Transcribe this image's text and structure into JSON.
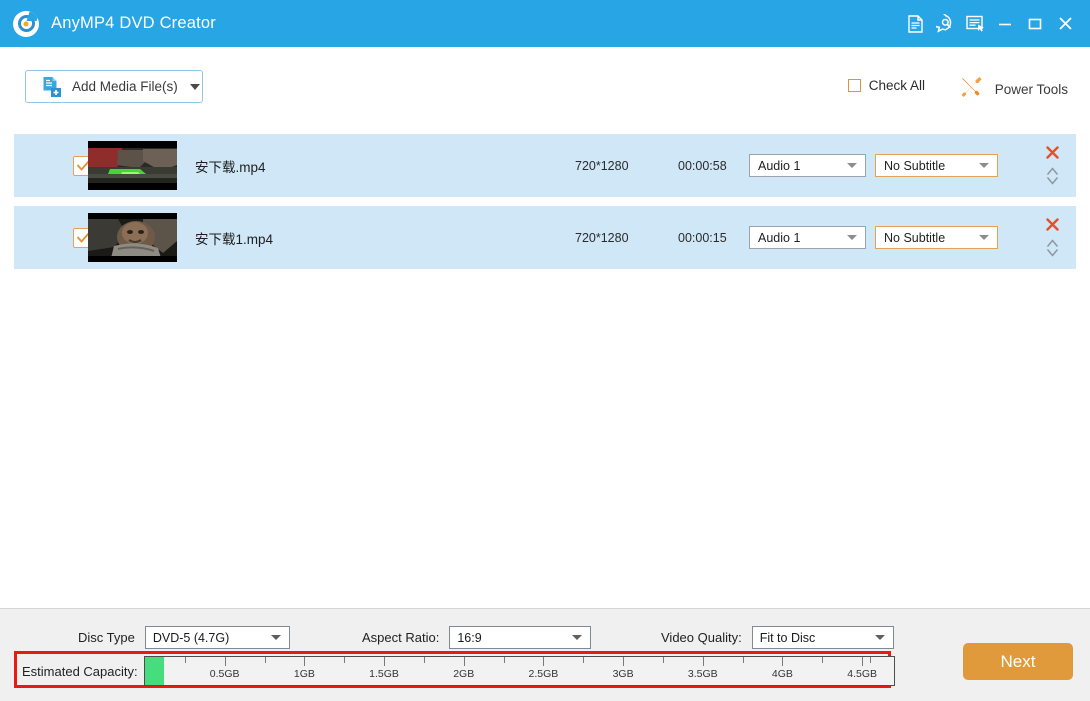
{
  "window": {
    "title": "AnyMP4 DVD Creator",
    "logo_icon": "anymp4-logo-icon",
    "titlebar_color": "#27a5e5",
    "buttons": [
      {
        "name": "register-icon",
        "glyph": "document"
      },
      {
        "name": "help-icon",
        "glyph": "speech-question"
      },
      {
        "name": "feedback-icon",
        "glyph": "form-cursor"
      },
      {
        "name": "minimize-icon",
        "glyph": "minimize"
      },
      {
        "name": "maximize-icon",
        "glyph": "maximize"
      },
      {
        "name": "close-icon",
        "glyph": "close"
      }
    ]
  },
  "toolbar": {
    "add_media_label": "Add Media File(s)",
    "add_media_icon": "add-file-icon",
    "check_all_label": "Check All",
    "check_all_checked": false,
    "power_tools_label": "Power Tools",
    "power_tools_icon": "tools-icon",
    "accent_orange": "#e0953c"
  },
  "files": [
    {
      "checked": true,
      "name": "安下载.mp4",
      "resolution": "720*1280",
      "duration": "00:00:58",
      "audio": "Audio 1",
      "subtitle": "No Subtitle",
      "thumbnail": "video-thumbnail"
    },
    {
      "checked": true,
      "name": "安下载1.mp4",
      "resolution": "720*1280",
      "duration": "00:00:15",
      "audio": "Audio 1",
      "subtitle": "No Subtitle",
      "thumbnail": "video-thumbnail"
    }
  ],
  "row_actions": {
    "delete_icon": "close-x-icon",
    "delete_color": "#e2522a",
    "reorder_icon": "up-down-chevron-icon"
  },
  "settings": {
    "disc_type_label": "Disc Type",
    "disc_type_value": "DVD-5 (4.7G)",
    "aspect_ratio_label": "Aspect Ratio:",
    "aspect_ratio_value": "16:9",
    "video_quality_label": "Video Quality:",
    "video_quality_value": "Fit to Disc"
  },
  "capacity": {
    "label": "Estimated Capacity:",
    "fill_percent": 2.6,
    "fill_color": "#46dd7f",
    "highlight_color": "#e81b0e",
    "max_gb": 4.7,
    "major_ticks": [
      "0.5GB",
      "1GB",
      "1.5GB",
      "2GB",
      "2.5GB",
      "3GB",
      "3.5GB",
      "4GB",
      "4.5GB"
    ],
    "major_tick_values": [
      0.5,
      1,
      1.5,
      2,
      2.5,
      3,
      3.5,
      4,
      4.5
    ],
    "minor_tick_values": [
      0.25,
      0.75,
      1.25,
      1.75,
      2.25,
      2.75,
      3.25,
      3.75,
      4.25,
      4.55
    ]
  },
  "next_button": {
    "label": "Next",
    "color": "#e09a3c"
  }
}
